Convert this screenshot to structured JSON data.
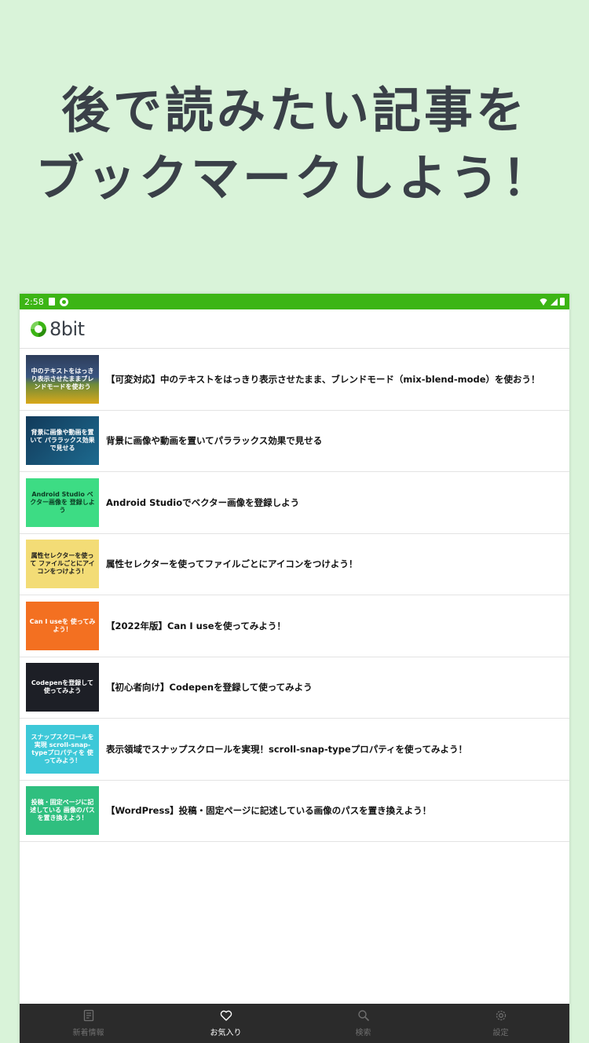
{
  "promo": {
    "line1": "後で読みたい記事を",
    "line2": "ブックマークしよう！"
  },
  "statusbar": {
    "time": "2:58",
    "bg_color": "#3cb515"
  },
  "appbar": {
    "logo_text": "8bit"
  },
  "articles": [
    {
      "title": "【可変対応】中のテキストをはっきり表示させたまま、ブレンドモード（mix-blend-mode）を使おう！",
      "thumb_text": "中のテキストをはっきり表示させたままブレンドモードを使おう"
    },
    {
      "title": "背景に画像や動画を置いてパララックス効果で見せる",
      "thumb_text": "背景に画像や動画を置いて パララックス効果で見せる"
    },
    {
      "title": "Android Studioでベクター画像を登録しよう",
      "thumb_text": "Android Studio ベクター画像を 登録しよう"
    },
    {
      "title": "属性セレクターを使ってファイルごとにアイコンをつけよう！",
      "thumb_text": "属性セレクターを使って ファイルごとにアイコンをつけよう！"
    },
    {
      "title": "【2022年版】Can I useを使ってみよう！",
      "thumb_text": "Can I useを 使ってみよう！"
    },
    {
      "title": "【初心者向け】Codepenを登録して使ってみよう",
      "thumb_text": "Codepenを登録して使ってみよう"
    },
    {
      "title": "表示領域でスナップスクロールを実現！scroll-snap-typeプロパティを使ってみよう！",
      "thumb_text": "スナップスクロールを実現 scroll-snap-typeプロパティを 使ってみよう！"
    },
    {
      "title": "【WordPress】投稿・固定ページに記述している画像のパスを置き換えよう！",
      "thumb_text": "投稿・固定ページに記述している 画像のパスを置き換えよう！"
    }
  ],
  "bottomnav": {
    "items": [
      {
        "label": "新着情報",
        "icon": "article-icon",
        "active": false
      },
      {
        "label": "お気入り",
        "icon": "heart-icon",
        "active": true
      },
      {
        "label": "検索",
        "icon": "search-icon",
        "active": false
      },
      {
        "label": "設定",
        "icon": "gear-icon",
        "active": false
      }
    ]
  }
}
